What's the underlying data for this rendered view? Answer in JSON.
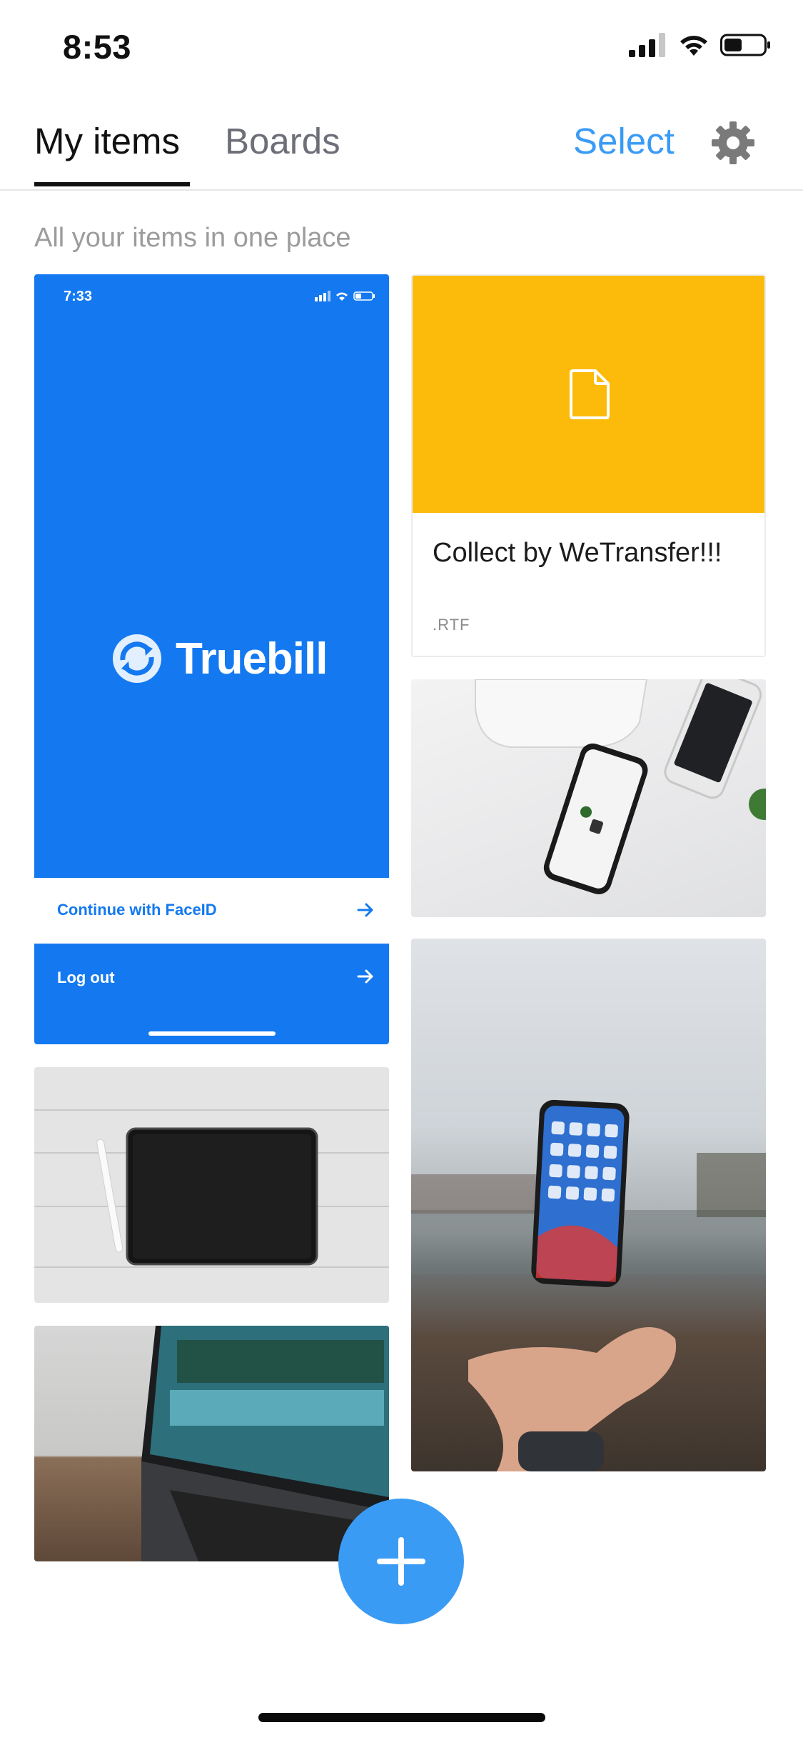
{
  "status_bar": {
    "time": "8:53"
  },
  "nav": {
    "tabs": [
      {
        "label": "My items",
        "active": true
      },
      {
        "label": "Boards",
        "active": false
      }
    ],
    "select_label": "Select",
    "settings_icon": "gear-icon"
  },
  "subtitle": "All your items in one place",
  "items": {
    "truebill": {
      "status_time": "7:33",
      "logo_text": "Truebill",
      "continue_label": "Continue with FaceID",
      "logout_label": "Log out"
    },
    "collect": {
      "title": "Collect by WeTransfer!!!",
      "extension": ".RTF",
      "icon": "document-icon"
    },
    "photos": [
      "phones-on-desk-photo",
      "tablet-and-pencil-photo",
      "laptop-photo",
      "floating-iphone-photo"
    ]
  },
  "fab_icon": "plus-icon",
  "colors": {
    "accent": "#3a9bf5",
    "truebill_blue": "#1479f0",
    "collect_yellow": "#fcba0a",
    "subtitle_gray": "#9c9c9c"
  }
}
